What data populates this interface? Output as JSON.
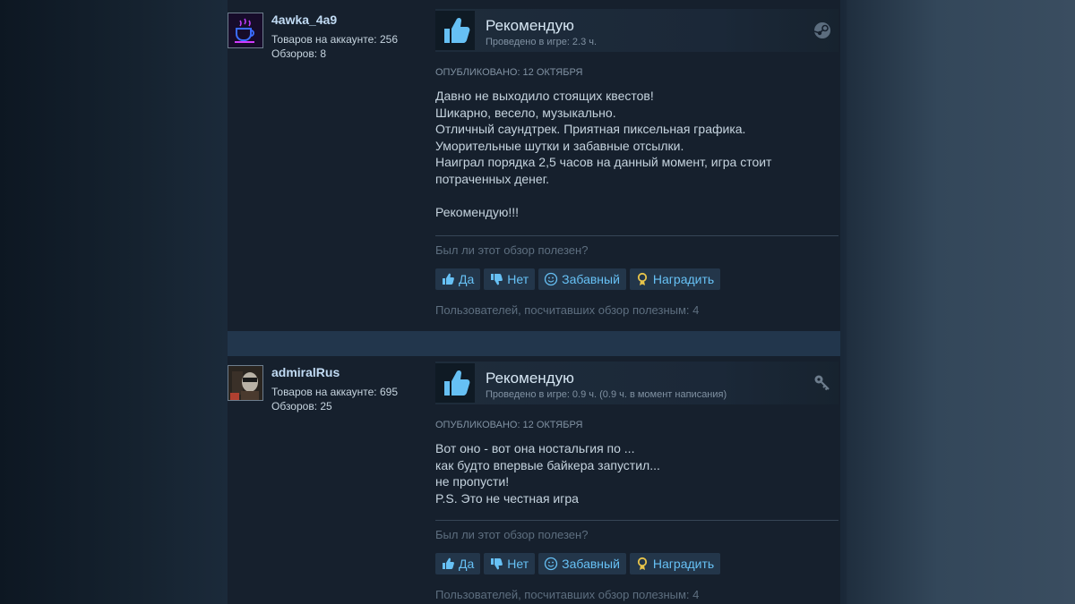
{
  "reviews": [
    {
      "username": "4awka_4a9",
      "products": "Товаров на аккаунте: 256",
      "review_count": "Обзоров: 8",
      "verdict": "Рекомендую",
      "hours": "Проведено в игре: 2.3 ч.",
      "posted": "ОПУБЛИКОВАНО: 12 ОКТЯБРЯ",
      "lines": [
        "Давно не выходило стоящих квестов!",
        "Шикарно, весело, музыкально.",
        "Отличный саундтрек. Приятная пиксельная графика.",
        "Уморительные шутки и забавные отсылки.",
        "Наиграл порядка 2,5 часов на данный момент, игра стоит",
        "потраченных денег.",
        "",
        "Рекомендую!!!"
      ],
      "helpful_question": "Был ли этот обзор полезен?",
      "buttons": {
        "yes": "Да",
        "no": "Нет",
        "funny": "Забавный",
        "award": "Наградить"
      },
      "helpful_count": "Пользователей, посчитавших обзор полезным: 4"
    },
    {
      "username": "admiralRus",
      "products": "Товаров на аккаунте: 695",
      "review_count": "Обзоров: 25",
      "verdict": "Рекомендую",
      "hours": "Проведено в игре: 0.9 ч. (0.9 ч. в момент написания)",
      "posted": "ОПУБЛИКОВАНО: 12 ОКТЯБРЯ",
      "lines": [
        "Вот оно - вот она ностальгия по ...",
        "как будто впервые байкера запустил...",
        "не пропусти!",
        "P.S. Это не честная игра"
      ],
      "helpful_question": "Был ли этот обзор полезен?",
      "buttons": {
        "yes": "Да",
        "no": "Нет",
        "funny": "Забавный",
        "award": "Наградить"
      },
      "helpful_count": "Пользователей, посчитавших обзор полезным: 4"
    }
  ],
  "icons": {
    "thumbs_up": "thumbs-up-icon",
    "thumbs_down": "thumbs-down-icon",
    "smiley": "smiley-icon",
    "award": "award-ribbon-icon",
    "steam": "steam-logo-icon",
    "key": "key-icon"
  },
  "colors": {
    "accent": "#67c1f5",
    "thumb": "#66c0f4",
    "award": "#e8c44a"
  }
}
